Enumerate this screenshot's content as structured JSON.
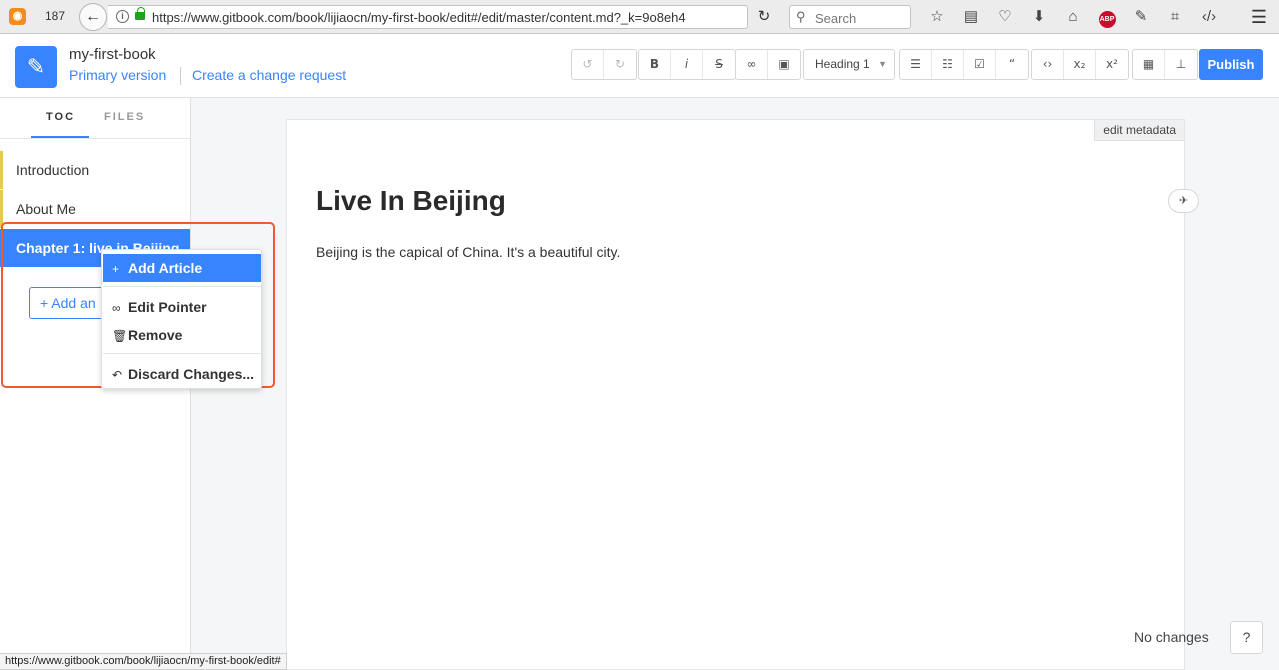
{
  "browser": {
    "tab_count": "187",
    "url": "https://www.gitbook.com/book/lijiaocn/my-first-book/edit#/edit/master/content.md?_k=9o8eh4",
    "search_placeholder": "Search",
    "abp_label": "ABP",
    "icons": [
      "rss-icon",
      "back-icon",
      "info-icon",
      "lock-icon",
      "reload-icon",
      "search-icon",
      "bookmark-star-icon",
      "reading-list-icon",
      "pocket-icon",
      "download-icon",
      "home-icon",
      "adblock-icon",
      "paint-icon",
      "crop-icon",
      "code-icon",
      "hamburger-menu-icon"
    ]
  },
  "header": {
    "book_title": "my-first-book",
    "version_link": "Primary version",
    "change_request_link": "Create a change request",
    "heading_select": "Heading 1",
    "publish_label": "Publish",
    "toolbar_icons": {
      "undo": "↺",
      "redo": "↻",
      "bold": "B",
      "italic": "i",
      "strike": "S",
      "link": "∞",
      "image": "▣",
      "bullet_list": "☰",
      "number_list": "☷",
      "task_list": "☑",
      "quote": "“",
      "code": "‹›",
      "subscript": "x₂",
      "superscript": "x²",
      "table": "▦",
      "footnote": "⊥"
    }
  },
  "sidebar": {
    "tabs": [
      {
        "label": "TOC"
      },
      {
        "label": "FILES"
      }
    ],
    "items": [
      {
        "label": "Introduction"
      },
      {
        "label": "About Me"
      },
      {
        "label": "Chapter 1: live in Beijing"
      }
    ],
    "add_another_label": "+ Add an"
  },
  "context_menu": {
    "items": [
      {
        "icon": "+",
        "label": "Add Article"
      },
      {
        "icon": "∞",
        "label": "Edit Pointer"
      },
      {
        "icon": "🗑",
        "label": "Remove"
      },
      {
        "icon": "↶",
        "label": "Discard Changes..."
      }
    ]
  },
  "editor": {
    "edit_metadata": "edit metadata",
    "heading": "Live In Beijing",
    "paragraph": "Beijing is the capical of China. It's a beautiful city.",
    "no_changes": "No changes",
    "help": "?"
  },
  "status_bar": {
    "url": "https://www.gitbook.com/book/lijiaocn/my-first-book/edit#"
  },
  "colors": {
    "accent": "#3884ff",
    "highlight_outline": "#ef5a2f",
    "toc_marker": "#e4c95a"
  }
}
